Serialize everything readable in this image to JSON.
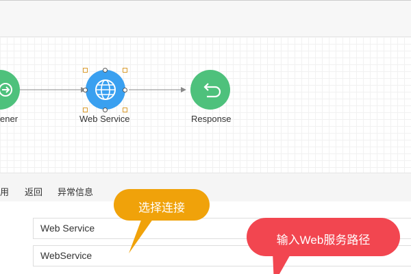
{
  "canvas": {
    "nodes": {
      "listener": {
        "label": "ener",
        "icon": "share-icon",
        "color": "#4ec17c"
      },
      "web_service": {
        "label": "Web Service",
        "icon": "globe-icon",
        "color": "#3aa0f0"
      },
      "response": {
        "label": "Response",
        "icon": "return-arrow-icon",
        "color": "#4ec17c"
      }
    }
  },
  "toolbar": {
    "items": [
      "用",
      "返回",
      "异常信息"
    ]
  },
  "form": {
    "row1": {
      "label": "",
      "value": "Web Service"
    },
    "row2": {
      "label": "",
      "value": "WebService"
    }
  },
  "callouts": {
    "select_connection": {
      "text": "选择连接",
      "color": "#f0a20a"
    },
    "enter_path": {
      "text": "输入Web服务路径",
      "color": "#f24650"
    }
  }
}
